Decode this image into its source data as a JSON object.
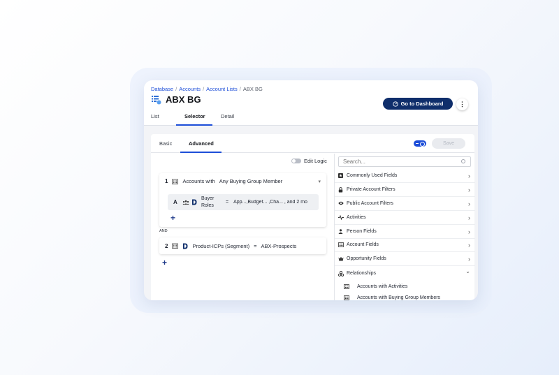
{
  "breadcrumb": [
    "Database",
    "Accounts",
    "Account Lists",
    "ABX BG"
  ],
  "page": {
    "title": "ABX BG"
  },
  "header": {
    "dashboard_label": "Go to Dashboard",
    "more_label": "⋮"
  },
  "tabs": [
    {
      "label": "List"
    },
    {
      "label": "Selector"
    },
    {
      "label": "Detail"
    }
  ],
  "subtabs": [
    {
      "label": "Basic"
    },
    {
      "label": "Advanced"
    }
  ],
  "toolbar": {
    "save_label": "Save",
    "edit_logic_label": "Edit Logic"
  },
  "rules": [
    {
      "number": "1",
      "text": "Accounts with",
      "condition": "Any Buying Group Member",
      "subrule": {
        "letter": "A",
        "field": "Buyer Roles",
        "operator": "=",
        "value": "App...,Budget... ,Cha... , and 2 mo"
      }
    },
    {
      "number": "2",
      "field": "Product-ICPs (Segment)",
      "operator": "=",
      "value": "ABX-Prospects"
    }
  ],
  "and_label": "AND",
  "add_label": "+",
  "search": {
    "placeholder": "Search..."
  },
  "field_groups": [
    {
      "label": "Commonly Used Fields",
      "icon": "star-box-icon"
    },
    {
      "label": "Private Account Filters",
      "icon": "lock-icon"
    },
    {
      "label": "Public Account Filters",
      "icon": "eye-icon"
    },
    {
      "label": "Activities",
      "icon": "activity-icon"
    },
    {
      "label": "Person Fields",
      "icon": "person-icon"
    },
    {
      "label": "Account Fields",
      "icon": "building-icon"
    },
    {
      "label": "Opportunity Fields",
      "icon": "crown-icon"
    },
    {
      "label": "Relationships",
      "icon": "relationships-icon"
    }
  ],
  "relationships": [
    {
      "label": "Accounts with Activities"
    },
    {
      "label": "Accounts with Buying Group Members"
    }
  ],
  "colors": {
    "accent": "#1d4ed8",
    "primary_button": "#0f2e6b"
  }
}
